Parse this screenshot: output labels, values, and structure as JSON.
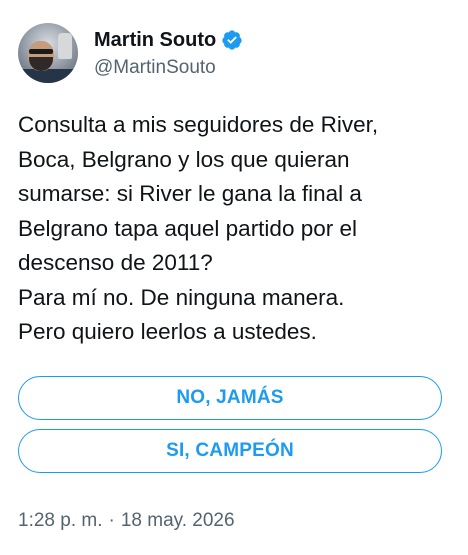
{
  "author": {
    "display_name": "Martin Souto",
    "handle": "@MartinSouto",
    "verified": true,
    "avatar_icon": "profile-photo"
  },
  "tweet": {
    "lines": [
      "Consulta a mis seguidores de River,",
      "Boca, Belgrano y los que quieran",
      "sumarse: si River le gana la final a",
      "Belgrano tapa aquel partido por el",
      "descenso de 2011?",
      "Para mí no. De ninguna manera.",
      "Pero quiero leerlos a ustedes."
    ],
    "time": "1:28 p. m.",
    "separator": "·",
    "date": "18 may. 2026"
  },
  "poll": {
    "options": [
      {
        "label": "NO, JAMÁS"
      },
      {
        "label": "SI, CAMPEÓN"
      }
    ]
  },
  "colors": {
    "accent": "#1d9bf0",
    "text": "#0f1419",
    "secondary": "#536471"
  }
}
